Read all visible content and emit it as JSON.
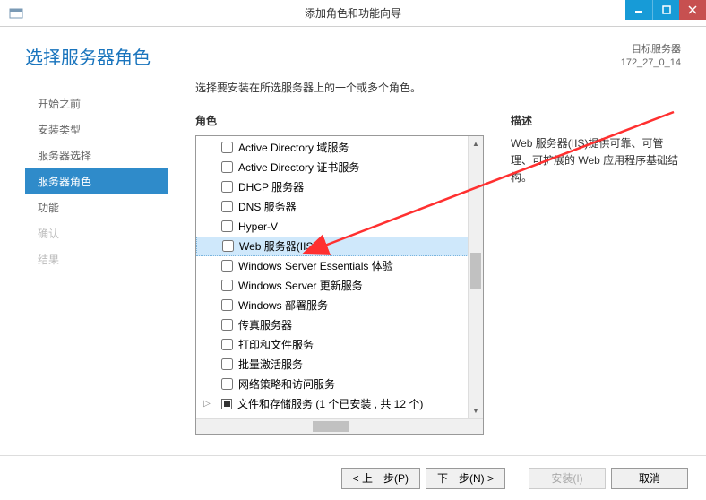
{
  "window": {
    "title": "添加角色和功能向导"
  },
  "header": {
    "page_title": "选择服务器角色",
    "server_label": "目标服务器",
    "server_name": "172_27_0_14"
  },
  "sidebar": {
    "items": [
      {
        "label": "开始之前",
        "state": "normal"
      },
      {
        "label": "安装类型",
        "state": "normal"
      },
      {
        "label": "服务器选择",
        "state": "normal"
      },
      {
        "label": "服务器角色",
        "state": "active"
      },
      {
        "label": "功能",
        "state": "normal"
      },
      {
        "label": "确认",
        "state": "disabled"
      },
      {
        "label": "结果",
        "state": "disabled"
      }
    ]
  },
  "main": {
    "instruction": "选择要安装在所选服务器上的一个或多个角色。",
    "roles_label": "角色",
    "desc_label": "描述",
    "description": "Web 服务器(IIS)提供可靠、可管理、可扩展的 Web 应用程序基础结构。",
    "roles": [
      {
        "label": "Active Directory 域服务",
        "checked": false
      },
      {
        "label": "Active Directory 证书服务",
        "checked": false
      },
      {
        "label": "DHCP 服务器",
        "checked": false
      },
      {
        "label": "DNS 服务器",
        "checked": false
      },
      {
        "label": "Hyper-V",
        "checked": false
      },
      {
        "label": "Web 服务器(IIS)",
        "checked": false,
        "selected": true
      },
      {
        "label": "Windows Server Essentials 体验",
        "checked": false
      },
      {
        "label": "Windows Server 更新服务",
        "checked": false
      },
      {
        "label": "Windows 部署服务",
        "checked": false
      },
      {
        "label": "传真服务器",
        "checked": false
      },
      {
        "label": "打印和文件服务",
        "checked": false
      },
      {
        "label": "批量激活服务",
        "checked": false
      },
      {
        "label": "网络策略和访问服务",
        "checked": false
      },
      {
        "label": "文件和存储服务 (1 个已安装 ,  共 12 个)",
        "checked": "partial",
        "expandable": true
      },
      {
        "label": "应用程序服务器",
        "checked": false
      }
    ]
  },
  "footer": {
    "prev": "< 上一步(P)",
    "next": "下一步(N) >",
    "install": "安装(I)",
    "cancel": "取消"
  }
}
